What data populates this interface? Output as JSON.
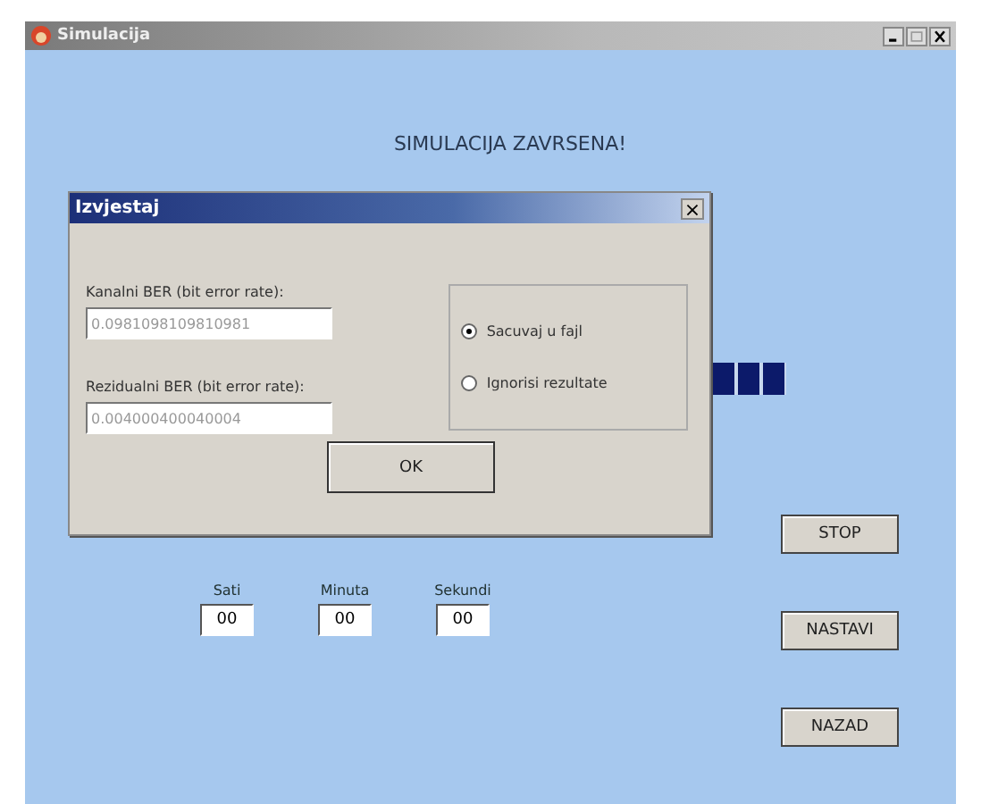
{
  "window": {
    "title": "Simulacija"
  },
  "heading": "SIMULACIJA ZAVRSENA!",
  "time": [
    {
      "label": "Sati",
      "value": "00"
    },
    {
      "label": "Minuta",
      "value": "00"
    },
    {
      "label": "Sekundi",
      "value": "00"
    }
  ],
  "buttons": [
    "STOP",
    "NASTAVI",
    "NAZAD"
  ],
  "dialog": {
    "title": "Izvjestaj",
    "close": "×",
    "fields": [
      {
        "label": "Kanalni BER (bit error rate):",
        "value": "0.0981098109810981",
        "disabled": true
      },
      {
        "label": "Rezidualni BER (bit error rate):",
        "value": "0.004000400040004",
        "disabled": true
      }
    ],
    "options": [
      {
        "label": "Sacuvaj u fajl",
        "selected": true
      },
      {
        "label": "Ignorisi rezultate",
        "selected": false
      }
    ],
    "ok": "OK"
  }
}
